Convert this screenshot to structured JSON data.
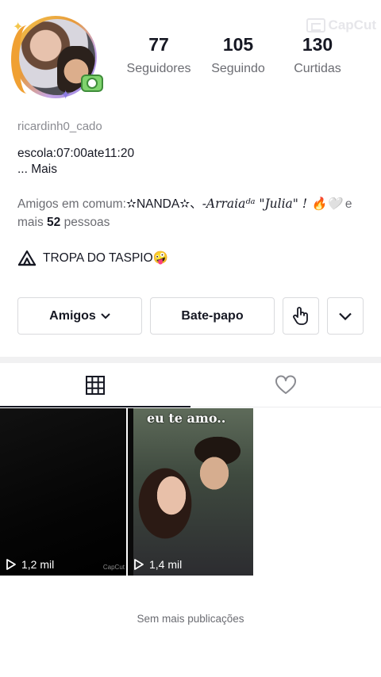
{
  "watermark": {
    "text": "CapCut"
  },
  "profile": {
    "username": "ricardinh0_cado",
    "stats": [
      {
        "value": "77",
        "label": "Seguidores"
      },
      {
        "value": "105",
        "label": "Seguindo"
      },
      {
        "value": "130",
        "label": "Curtidas"
      }
    ],
    "bio_line1": "escola:07:00ate11:20",
    "bio_more": "...  Mais",
    "mutual": {
      "prefix": "Amigos em comum:",
      "name1": "✫NANDA✫、",
      "name2": "-Arraiaᵈᵃ \"Julia\" ! 🔥🤍",
      "and": " e",
      "mais": "mais ",
      "count": "52",
      "suffix": " pessoas"
    },
    "group": {
      "icon": "tent-icon",
      "text": "TROPA DO TASPIO🤪"
    }
  },
  "actions": {
    "friends_label": "Amigos",
    "chat_label": "Bate-papo",
    "hand_icon": "pointing-hand-icon",
    "more_icon": "chevron-down-icon"
  },
  "tabs": [
    {
      "icon": "grid-icon",
      "active": true
    },
    {
      "icon": "heart-icon",
      "active": false
    }
  ],
  "posts": [
    {
      "views": "1,2 mil",
      "watermark": "CapCut",
      "caption": ""
    },
    {
      "views": "1,4 mil",
      "caption": "eu te amo.."
    }
  ],
  "footer_text": "Sem mais publicações"
}
